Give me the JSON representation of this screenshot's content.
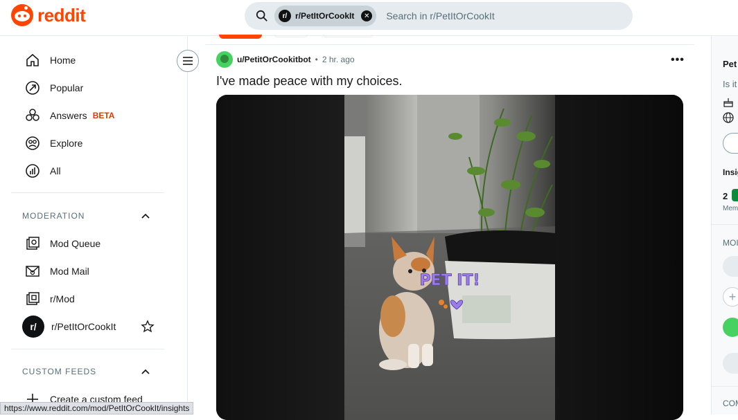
{
  "brand": {
    "name": "reddit",
    "accent": "#ff4500"
  },
  "search": {
    "chip_avatar": "r/",
    "chip_label": "r/PetItOrCookIt",
    "placeholder": "Search in r/PetItOrCookIt"
  },
  "sidebar": {
    "nav": [
      {
        "label": "Home",
        "icon": "home-icon"
      },
      {
        "label": "Popular",
        "icon": "popular-icon"
      },
      {
        "label": "Answers",
        "badge": "BETA",
        "icon": "answers-icon"
      },
      {
        "label": "Explore",
        "icon": "explore-icon"
      },
      {
        "label": "All",
        "icon": "all-icon"
      }
    ],
    "moderation_title": "MODERATION",
    "moderation": [
      {
        "label": "Mod Queue",
        "icon": "mod-queue-icon"
      },
      {
        "label": "Mod Mail",
        "icon": "mod-mail-icon"
      },
      {
        "label": "r/Mod",
        "icon": "r-mod-icon"
      },
      {
        "label": "r/PetItOrCookIt",
        "avatar": "r/",
        "icon": "star-icon"
      }
    ],
    "custom_feeds_title": "CUSTOM FEEDS",
    "create_feed": "Create a custom feed"
  },
  "post": {
    "author": "u/PetitOrCookitbot",
    "separator": "•",
    "time": "2 hr. ago",
    "title": "I've made peace with my choices.",
    "overlay_text": "PET IT!"
  },
  "right_panel": {
    "line1": "Pet",
    "line2": "Is it",
    "insights": "Insig",
    "count": "2",
    "members": "Mem",
    "mod": "MOI",
    "com": "COM"
  },
  "status_url": "https://www.reddit.com/mod/PetItOrCookIt/insights"
}
